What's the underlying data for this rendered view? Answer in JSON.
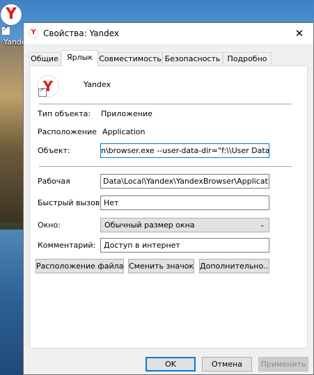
{
  "desktop": {
    "icon_label": "Yandex"
  },
  "window": {
    "title": "Свойства: Yandex",
    "close_icon": "close-icon"
  },
  "tabs": [
    {
      "label": "Общие",
      "active": false
    },
    {
      "label": "Ярлык",
      "active": true
    },
    {
      "label": "Совместимость",
      "active": false
    },
    {
      "label": "Безопасность",
      "active": false
    },
    {
      "label": "Подробно",
      "active": false
    }
  ],
  "shortcut": {
    "name": "Yandex",
    "object_type_label": "Тип объекта:",
    "object_type_value": "Приложение",
    "location_label": "Расположение",
    "location_value": "Application",
    "target_label": "Объект:",
    "target_value": "n\\browser.exe --user-data-dir=\"f:\\\\User Data\"",
    "workdir_label": "Рабочая",
    "workdir_value": "Data\\Local\\Yandex\\YandexBrowser\\Application",
    "hotkey_label": "Быстрый вызов:",
    "hotkey_value": "Нет",
    "window_label": "Окно:",
    "window_value": "Обычный размер окна",
    "comment_label": "Комментарий:",
    "comment_value": "Доступ в интернет"
  },
  "buttons": {
    "open_location": "Расположение файла",
    "change_icon": "Сменить значок...",
    "advanced": "Дополнительно...",
    "ok": "OK",
    "cancel": "Отмена",
    "apply": "Применить"
  },
  "colors": {
    "accent": "#0078d7",
    "yandex_red": "#e21a1a"
  }
}
